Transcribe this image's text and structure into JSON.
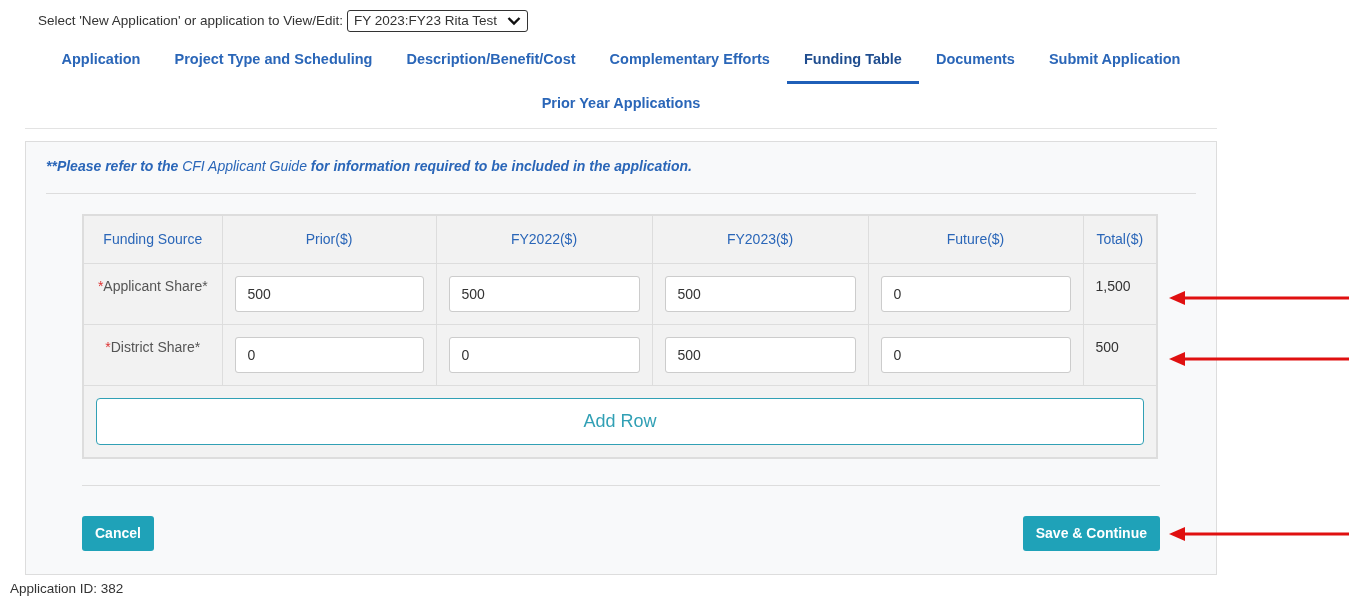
{
  "selector": {
    "label": "Select 'New Application' or application to View/Edit:",
    "value": "FY 2023:FY23 Rita Test"
  },
  "tabs": [
    {
      "label": "Application",
      "selected": false
    },
    {
      "label": "Project Type and Scheduling",
      "selected": false
    },
    {
      "label": "Description/Benefit/Cost",
      "selected": false
    },
    {
      "label": "Complementary Efforts",
      "selected": false
    },
    {
      "label": "Funding Table",
      "selected": true
    },
    {
      "label": "Documents",
      "selected": false
    },
    {
      "label": "Submit Application",
      "selected": false
    },
    {
      "label": "Prior Year Applications",
      "selected": false
    }
  ],
  "notice": {
    "before": "**Please refer to the",
    "link": "CFI Applicant Guide",
    "after": "for information required to be included in the application."
  },
  "table": {
    "columns": [
      "Funding Source",
      "Prior($)",
      "FY2022($)",
      "FY2023($)",
      "Future($)",
      "Total($)"
    ],
    "rows": [
      {
        "marker": "*",
        "source": "Applicant Share*",
        "values": [
          "500",
          "500",
          "500",
          "0"
        ],
        "total": "1,500",
        "arrow": true
      },
      {
        "marker": "*",
        "source": "District Share*",
        "values": [
          "0",
          "0",
          "500",
          "0"
        ],
        "total": "500",
        "arrow": true
      }
    ],
    "add_button": "Add Row"
  },
  "buttons": {
    "cancel": "Cancel",
    "save": "Save & Continue",
    "save_arrow": true
  },
  "footer": "Application ID: 382"
}
